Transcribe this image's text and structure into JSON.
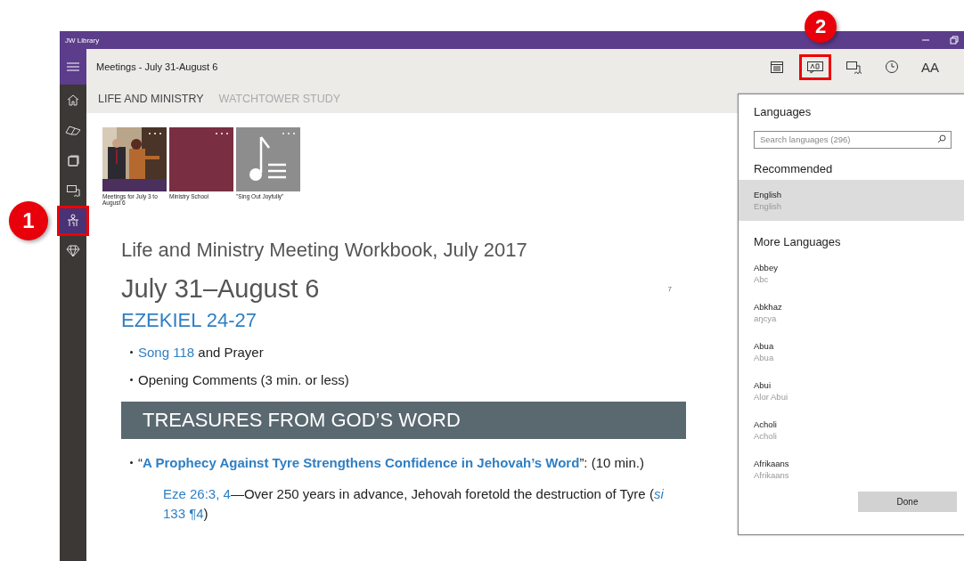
{
  "window": {
    "title": "JW Library"
  },
  "toolbar": {
    "title": "Meetings - July 31-August 6",
    "buttons": [
      {
        "kind": "calendar",
        "highlighted": false
      },
      {
        "kind": "language",
        "highlighted": true
      },
      {
        "kind": "media",
        "highlighted": false
      },
      {
        "kind": "history",
        "highlighted": false
      },
      {
        "kind": "text-size",
        "label": "AA",
        "highlighted": false
      }
    ]
  },
  "sidebar": {
    "items": [
      {
        "kind": "home",
        "selected": false,
        "highlighted": false
      },
      {
        "kind": "bible",
        "selected": false,
        "highlighted": false
      },
      {
        "kind": "publications",
        "selected": false,
        "highlighted": false
      },
      {
        "kind": "media",
        "selected": false,
        "highlighted": false
      },
      {
        "kind": "meetings",
        "selected": true,
        "highlighted": true
      },
      {
        "kind": "gems",
        "selected": false,
        "highlighted": false
      }
    ]
  },
  "tabs": [
    {
      "label": "LIFE AND MINISTRY",
      "selected": true
    },
    {
      "label": "WATCHTOWER STUDY",
      "selected": false
    }
  ],
  "thumbnails": [
    {
      "kind": "picture",
      "caption": "Meetings for July 3 to August 6"
    },
    {
      "kind": "plain",
      "color": "#7a2e42",
      "caption": "Ministry School"
    },
    {
      "kind": "music",
      "caption": "\"Sing Out Joyfully\""
    }
  ],
  "article": {
    "publication": "Life and Ministry Meeting Workbook, July 2017",
    "page": "7",
    "date": "July 31–August 6",
    "reading": "EZEKIEL 24-27",
    "blocks": [
      {
        "kind": "bullet",
        "parts": [
          {
            "kind": "link",
            "text": "Song 118"
          },
          {
            "kind": "plain",
            "text": " and Prayer"
          }
        ]
      },
      {
        "kind": "bullet",
        "parts": [
          {
            "kind": "plain",
            "text": "Opening Comments (3 min. or less)"
          }
        ]
      },
      {
        "kind": "section",
        "text": "TREASURES FROM GOD’S WORD"
      },
      {
        "kind": "bullet",
        "parts": [
          {
            "kind": "plain",
            "text": "“"
          },
          {
            "kind": "bold-link",
            "text": "A Prophecy Against Tyre Strengthens Confidence in Jehovah’s Word"
          },
          {
            "kind": "plain",
            "text": "”: (10 min.)"
          }
        ]
      },
      {
        "kind": "note",
        "parts": [
          {
            "kind": "link",
            "text": "Eze 26:3, 4"
          },
          {
            "kind": "plain",
            "text": "—Over 250 years in advance, Jehovah foretold the destruction of Tyre ("
          },
          {
            "kind": "italic-link",
            "text": "si"
          },
          {
            "kind": "link",
            "text": "133 ¶4"
          },
          {
            "kind": "plain",
            "text": ")"
          }
        ]
      }
    ]
  },
  "panel": {
    "title": "Languages",
    "search": {
      "placeholder": "Search languages (296)"
    },
    "groups": [
      {
        "heading": "Recommended",
        "languages": [
          {
            "name": "English",
            "native": "English",
            "selected": true
          }
        ]
      },
      {
        "heading": "More Languages",
        "languages": [
          {
            "name": "Abbey",
            "native": "Abc",
            "selected": false
          },
          {
            "name": "Abkhaz",
            "native": "aŋcya",
            "selected": false
          },
          {
            "name": "Abua",
            "native": "Abua",
            "selected": false
          },
          {
            "name": "Abui",
            "native": "Alor Abui",
            "selected": false
          },
          {
            "name": "Acholi",
            "native": "Acholi",
            "selected": false
          },
          {
            "name": "Afrikaans",
            "native": "Afrikaans",
            "selected": false
          }
        ]
      }
    ],
    "done": "Done"
  },
  "callouts": [
    {
      "number": "1"
    },
    {
      "number": "2"
    }
  ]
}
